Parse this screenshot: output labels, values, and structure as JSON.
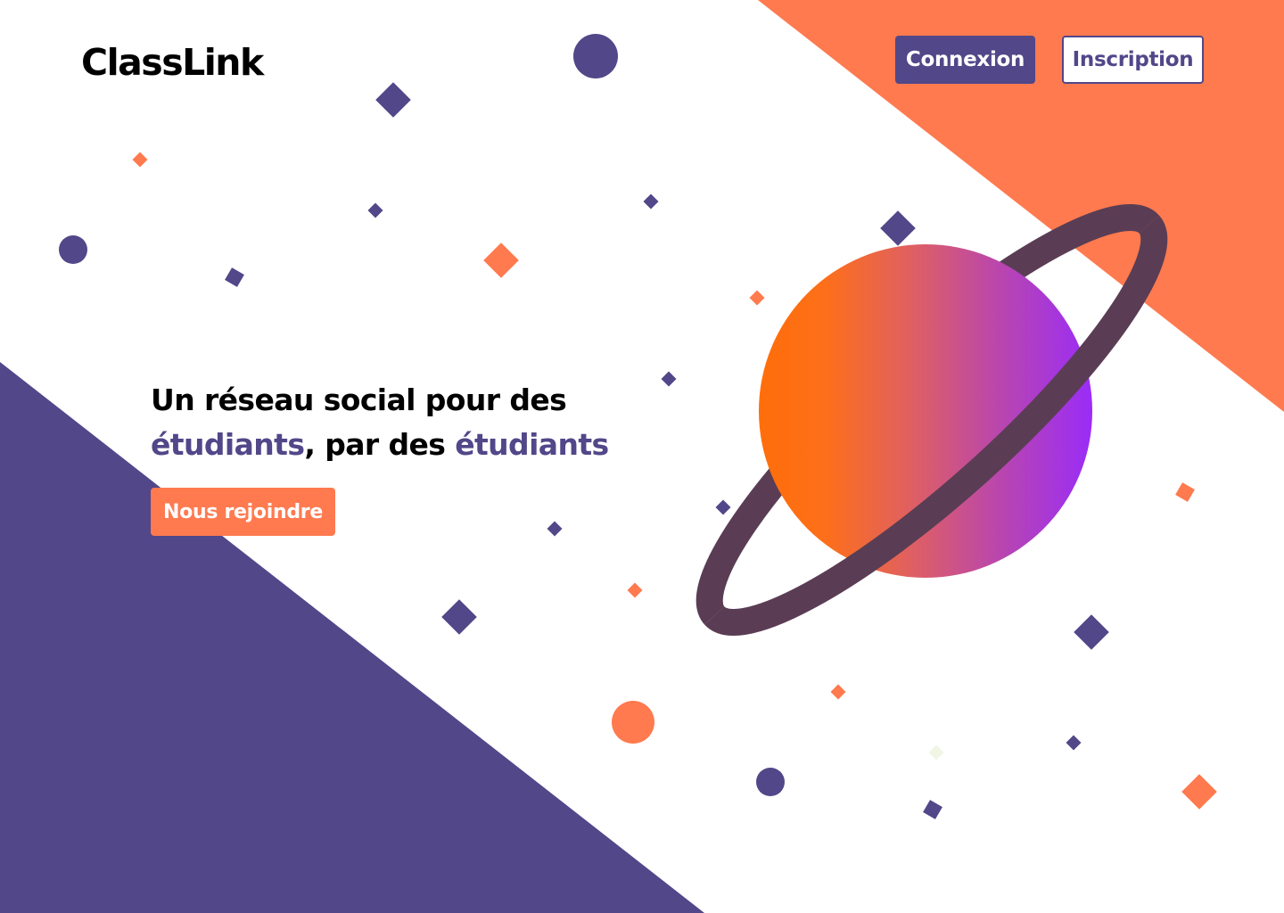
{
  "brand": {
    "name": "ClassLink"
  },
  "nav": {
    "login_label": "Connexion",
    "signup_label": "Inscription"
  },
  "hero": {
    "title_line1": "Un réseau social pour des",
    "title_word1": "étudiants",
    "title_mid": ", par des ",
    "title_word2": "étudiants",
    "cta_label": "Nous rejoindre"
  },
  "colors": {
    "purple": "#514789",
    "orange": "#ff7a4f",
    "ring": "#5a3d54",
    "planet_gradient_start": "#ff7010",
    "planet_gradient_end": "#9a2cf8",
    "text": "#000000",
    "background": "#ffffff"
  },
  "illustration": {
    "planet": "planet-illustration",
    "ring": "planet-ring",
    "decor": "confetti-shapes"
  }
}
